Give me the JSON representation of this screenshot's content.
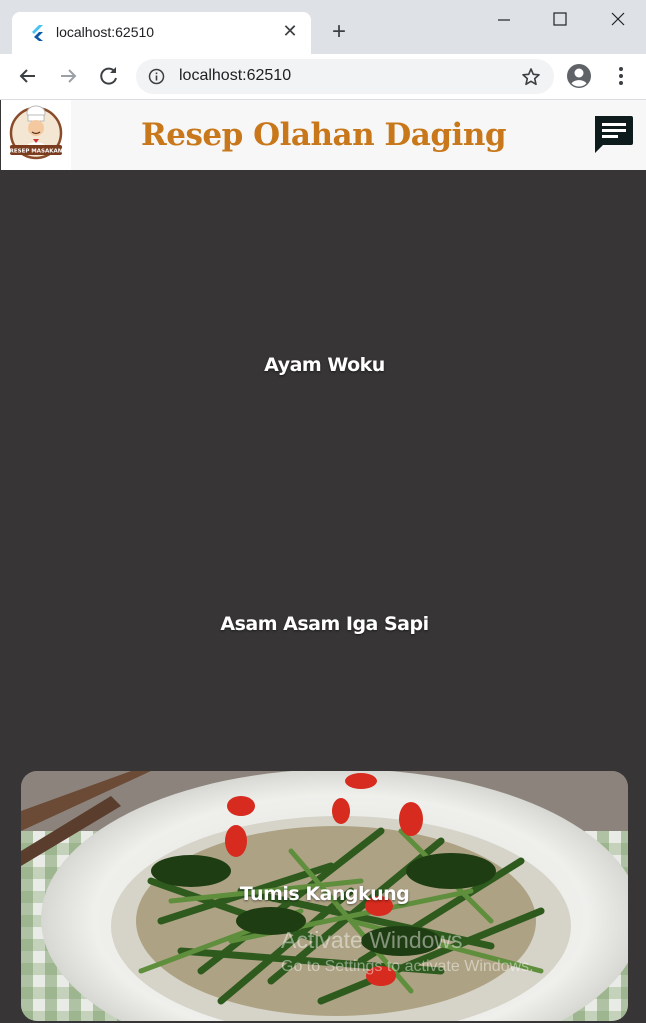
{
  "browser": {
    "tab_title": "localhost:62510",
    "tab_close": "✕",
    "new_tab": "+",
    "url": "localhost:62510"
  },
  "app_bar": {
    "title": "Resep Olahan Daging",
    "logo_text": "RESEP MASAKAN",
    "title_color": "#c8781a"
  },
  "recipes": [
    {
      "name": "Ayam Woku"
    },
    {
      "name": "Asam Asam Iga Sapi"
    },
    {
      "name": "Tumis Kangkung"
    }
  ],
  "watermark": {
    "line1": "Activate Windows",
    "line2": "Go to Settings to activate Windows."
  }
}
